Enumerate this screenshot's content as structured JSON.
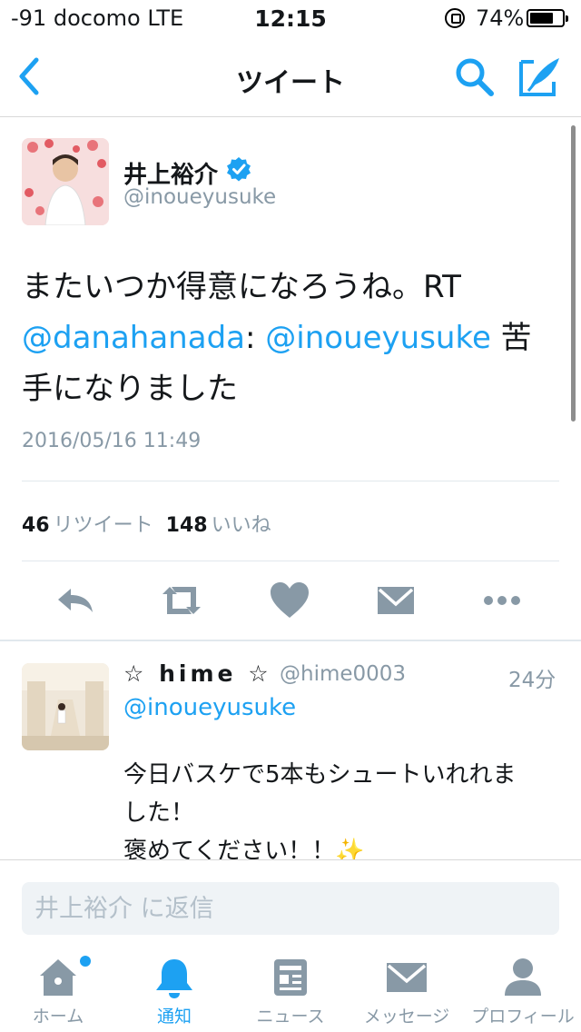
{
  "status_bar": {
    "carrier": "-91 docomo   LTE",
    "time": "12:15",
    "battery_percent": "74%",
    "battery_level": 0.74
  },
  "nav": {
    "title": "ツイート",
    "back_icon": "chevron-left-icon",
    "search_icon": "search-icon",
    "compose_icon": "compose-icon"
  },
  "tweet": {
    "author_name": "井上裕介",
    "author_handle": "@inoueyusuke",
    "verified": true,
    "text_part1": "またいつか得意になろうね。RT ",
    "mention1": "@danahanada",
    "text_part2": ": ",
    "mention2": "@inoueyusuke",
    "text_part3": " 苦手になりました",
    "timestamp": "2016/05/16 11:49",
    "retweet_count": "46",
    "retweet_label": "リツイート",
    "like_count": "148",
    "like_label": "いいね"
  },
  "actions": [
    "reply-icon",
    "retweet-icon",
    "like-icon",
    "direct-message-icon",
    "more-icon"
  ],
  "reply": {
    "display_name": "☆ hime ☆",
    "handle": "@hime0003",
    "time": "24分",
    "mention": "@inoueyusuke",
    "line1": "今日バスケで5本もシュートいれれま",
    "line2": "した！",
    "line3": "褒めてください！！✨"
  },
  "reply_box": {
    "placeholder": "井上裕介 に返信"
  },
  "tabs": [
    {
      "label": "ホーム",
      "icon": "home-icon",
      "active": false
    },
    {
      "label": "通知",
      "icon": "bell-icon",
      "active": true
    },
    {
      "label": "ニュース",
      "icon": "news-icon",
      "active": false
    },
    {
      "label": "メッセージ",
      "icon": "envelope-icon",
      "active": false
    },
    {
      "label": "プロフィール",
      "icon": "person-icon",
      "active": false
    }
  ],
  "colors": {
    "accent": "#1da1f2",
    "secondary_text": "#8899a6",
    "icon_gray": "#8899a6"
  }
}
